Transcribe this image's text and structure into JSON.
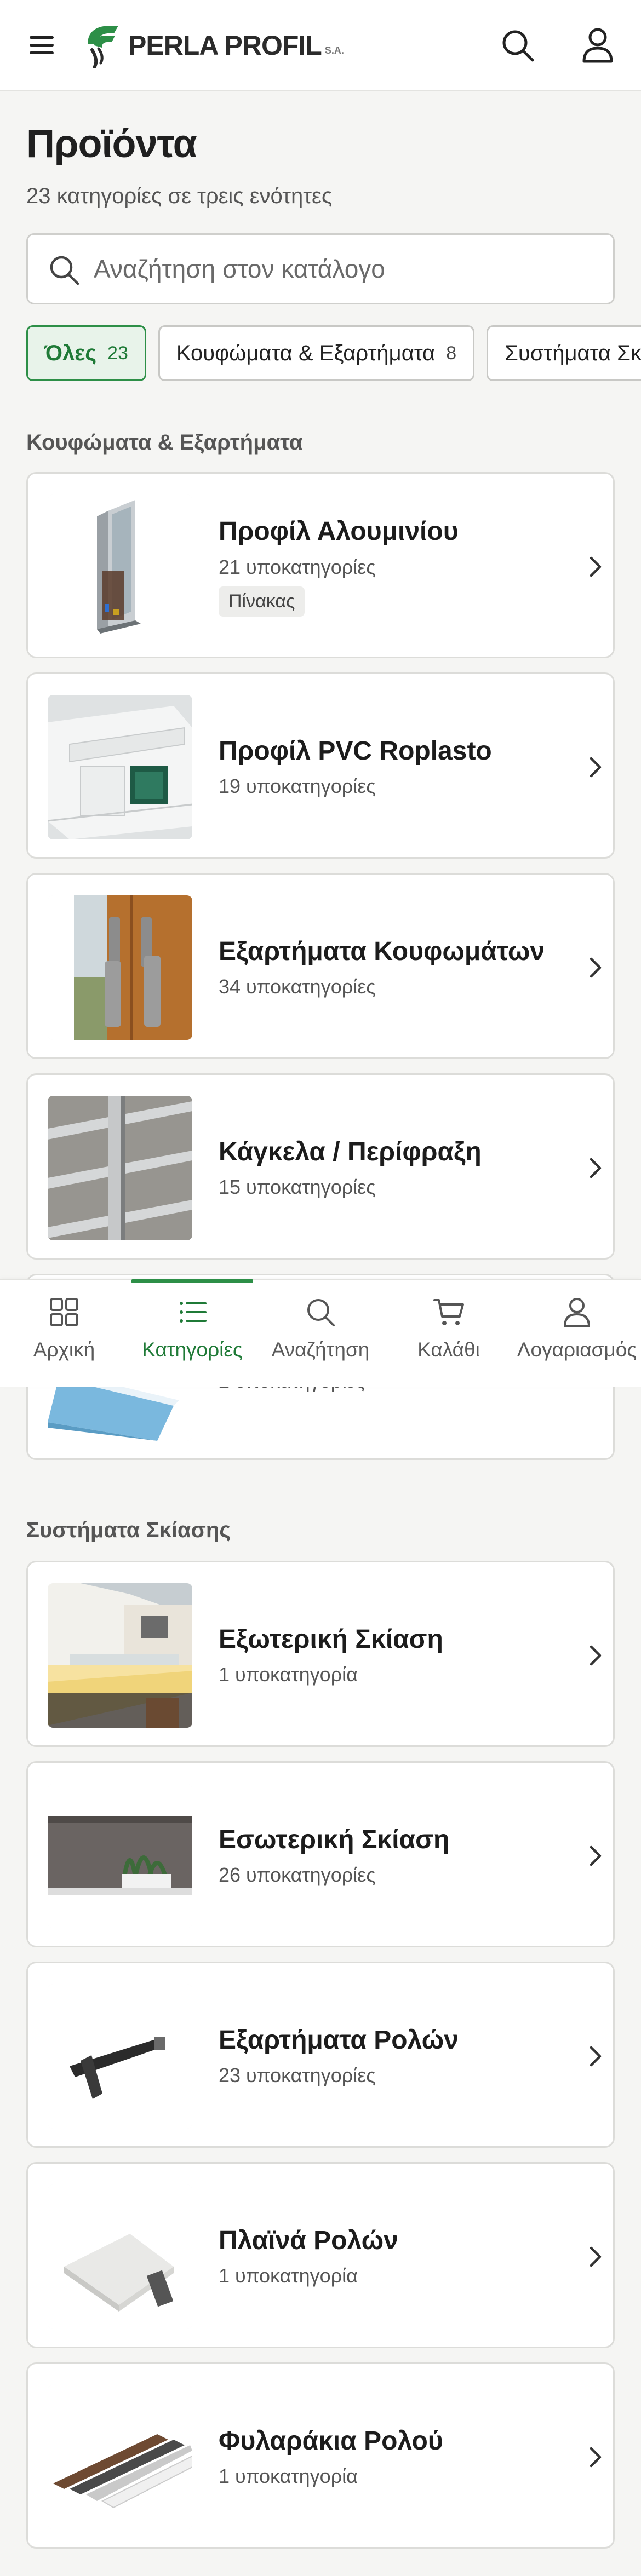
{
  "header": {
    "logo_text": "PERLA PROFIL",
    "logo_suffix": "S.A.",
    "brand_color": "#2d8f47"
  },
  "page": {
    "title": "Προϊόντα",
    "subtitle": "23 κατηγορίες σε τρεις ενότητες"
  },
  "search": {
    "placeholder": "Αναζήτηση στον κατάλογο",
    "value": ""
  },
  "chips": [
    {
      "label": "Όλες",
      "count": "23",
      "active": true
    },
    {
      "label": "Κουφώματα & Εξαρτήματα",
      "count": "8",
      "active": false
    },
    {
      "label": "Συστήματα Σκίασης",
      "count": "",
      "active": false
    }
  ],
  "sections": [
    {
      "title": "Κουφώματα & Εξαρτήματα",
      "items": [
        {
          "name": "Προφίλ Αλουμινίου",
          "sub": "21 υποκατηγορίες",
          "tag": "Πίνακας",
          "icon": "aluminium-window-profile-image"
        },
        {
          "name": "Προφίλ PVC Roplasto",
          "sub": "19 υποκατηγορίες",
          "tag": "",
          "icon": "pvc-profile-image"
        },
        {
          "name": "Εξαρτήματα Κουφωμάτων",
          "sub": "34 υποκατηγορίες",
          "tag": "",
          "icon": "window-handle-image"
        },
        {
          "name": "Κάγκελα / Περίφραξη",
          "sub": "15 υποκατηγορίες",
          "tag": "",
          "icon": "railing-image"
        },
        {
          "name": "",
          "sub": "2 υποκατηγορίες",
          "tag": "",
          "icon": "panel-image"
        }
      ]
    },
    {
      "title": "Συστήματα Σκίασης",
      "items": [
        {
          "name": "Εξωτερική Σκίαση",
          "sub": "1 υποκατηγορία",
          "icon": "awning-image"
        },
        {
          "name": "Εσωτερική Σκίαση",
          "sub": "26 υποκατηγορίες",
          "icon": "interior-blind-image"
        },
        {
          "name": "Εξαρτήματα Ρολών",
          "sub": "23 υποκατηγορίες",
          "icon": "roller-bracket-image"
        },
        {
          "name": "Πλαϊνά Ρολών",
          "sub": "1 υποκατηγορία",
          "icon": "roller-side-cap-image"
        },
        {
          "name": "Φυλαράκια Ρολού",
          "sub": "1 υποκατηγορία",
          "icon": "roller-slats-image"
        }
      ]
    }
  ],
  "tabbar": {
    "active_color": "#1f7a37",
    "tabs": [
      {
        "label": "Αρχική",
        "icon": "grid-icon"
      },
      {
        "label": "Κατηγορίες",
        "icon": "list-icon",
        "active": true
      },
      {
        "label": "Αναζήτηση",
        "icon": "search-icon"
      },
      {
        "label": "Καλάθι",
        "icon": "cart-icon"
      },
      {
        "label": "Λογαριασμός",
        "icon": "user-icon"
      }
    ]
  }
}
